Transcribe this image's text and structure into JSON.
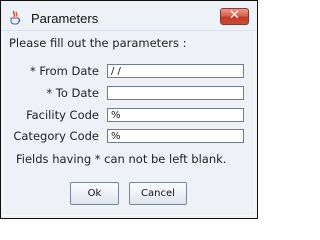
{
  "window": {
    "title": "Parameters",
    "close_glyph": "✕",
    "icon": "java-cup-icon"
  },
  "form": {
    "intro": "Please fill out the parameters :",
    "fields": [
      {
        "label": "* From Date",
        "value": "/ /"
      },
      {
        "label": "* To Date",
        "value": ""
      },
      {
        "label": "Facility Code",
        "value": "%"
      },
      {
        "label": "Category Code",
        "value": "%"
      }
    ],
    "note": "Fields having * can not be left blank."
  },
  "buttons": {
    "ok_label": "Ok",
    "cancel_label": "Cancel"
  },
  "colors": {
    "window_bg": "#eef1f6",
    "close_red": "#c84c36"
  }
}
